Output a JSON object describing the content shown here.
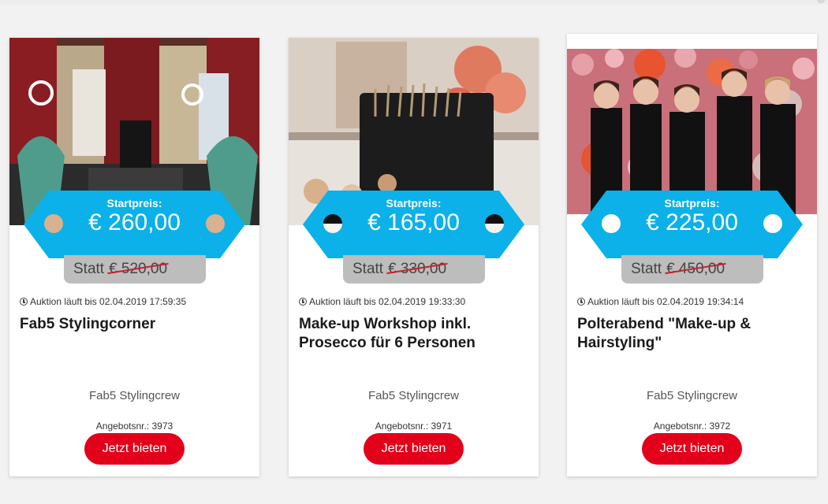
{
  "colors": {
    "tag": "#0bb1e8",
    "button": "#e2001a",
    "statt_bg": "#bdbdbd",
    "strike": "#c0272d"
  },
  "cards": [
    {
      "photo_icon": "photo-event-booth",
      "price_label": "Startpreis:",
      "price": "€ 260,00",
      "statt_word": "Statt",
      "old_price": "€ 520,00",
      "auction_text": "Auktion läuft bis 02.04.2019 17:59:35",
      "title": "Fab5 Stylingcorner",
      "provider": "Fab5 Stylingcrew",
      "offer_no": "Angebotsnr.: 3973",
      "button": "Jetzt bieten"
    },
    {
      "photo_icon": "photo-makeup-brushes",
      "price_label": "Startpreis:",
      "price": "€ 165,00",
      "statt_word": "Statt",
      "old_price": "€ 330,00",
      "auction_text": "Auktion läuft bis 02.04.2019 19:33:30",
      "title": "Make-up Workshop inkl. Prosecco für 6 Personen",
      "provider": "Fab5 Stylingcrew",
      "offer_no": "Angebotsnr.: 3971",
      "button": "Jetzt bieten"
    },
    {
      "photo_icon": "photo-group-balloons",
      "price_label": "Startpreis:",
      "price": "€ 225,00",
      "statt_word": "Statt",
      "old_price": "€ 450,00",
      "auction_text": "Auktion läuft bis 02.04.2019 19:34:14",
      "title": "Polterabend \"Make-up & Hairstyling\"",
      "provider": "Fab5 Stylingcrew",
      "offer_no": "Angebotsnr.: 3972",
      "button": "Jetzt bieten"
    }
  ]
}
